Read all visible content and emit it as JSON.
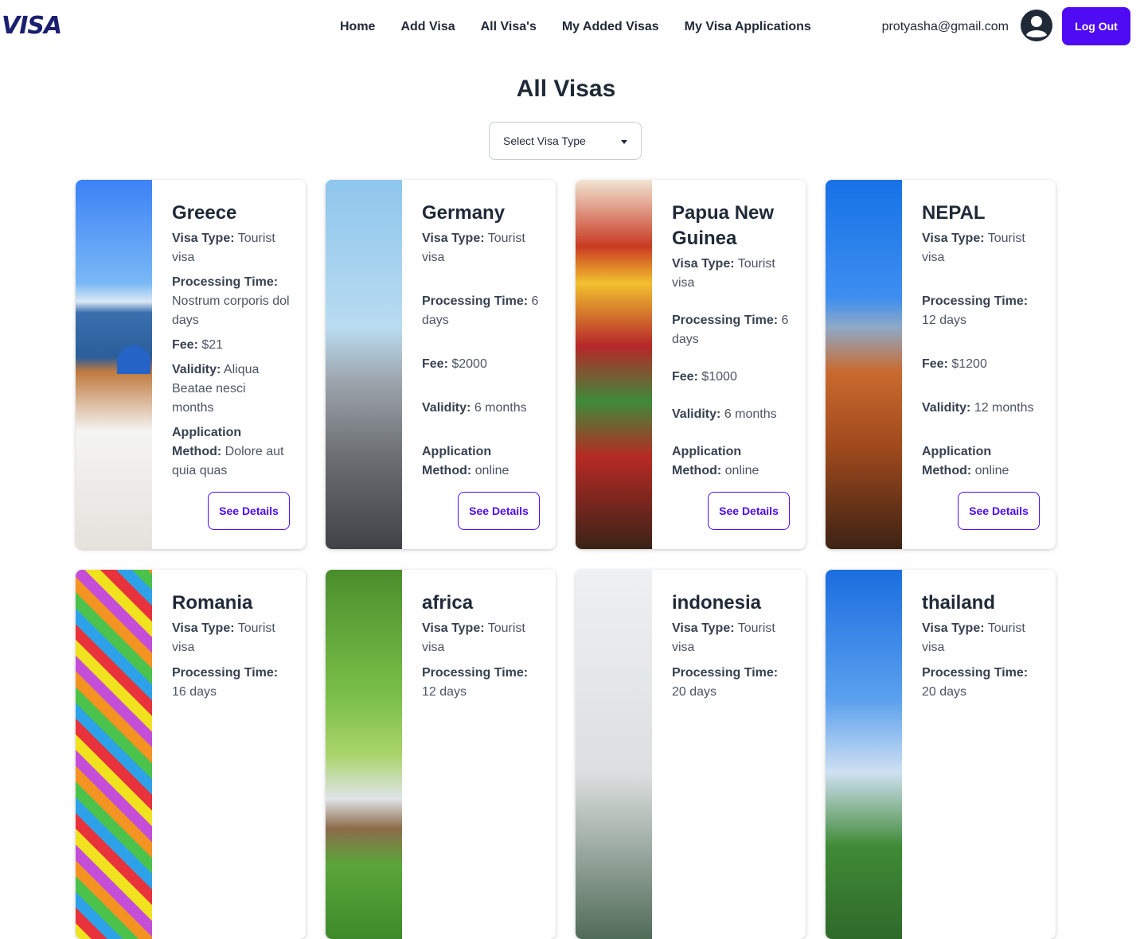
{
  "brand": {
    "logo_text": "VISA",
    "accent_color": "#4f0bf4",
    "logo_color": "#1a1f71"
  },
  "nav": {
    "links": [
      "Home",
      "Add Visa",
      "All Visa's",
      "My Added Visas",
      "My Visa Applications"
    ]
  },
  "user": {
    "email": "protyasha@gmail.com",
    "avatar_icon": "user-circle-icon",
    "logout_label": "Log Out"
  },
  "page": {
    "title": "All Visas",
    "filter": {
      "selected": "Select Visa Type"
    }
  },
  "labels": {
    "visa_type": "Visa Type:",
    "processing_time": "Processing Time:",
    "fee": "Fee:",
    "validity": "Validity:",
    "application_method": "Application Method:",
    "see_details": "See Details"
  },
  "visas": [
    {
      "country": "Greece",
      "visa_type": "Tourist visa",
      "processing_time": "Nostrum corporis dol days",
      "fee": "$21",
      "validity": "Aliqua Beatae nesci months",
      "application_method": "Dolore aut quia quas"
    },
    {
      "country": "Germany",
      "visa_type": "Tourist visa",
      "processing_time": "6 days",
      "fee": "$2000",
      "validity": "6 months",
      "application_method": "online"
    },
    {
      "country": "Papua New Guinea",
      "visa_type": "Tourist visa",
      "processing_time": "6 days",
      "fee": "$1000",
      "validity": "6 months",
      "application_method": "online"
    },
    {
      "country": "NEPAL",
      "visa_type": "Tourist visa",
      "processing_time": "12 days",
      "fee": "$1200",
      "validity": "12 months",
      "application_method": "online"
    },
    {
      "country": "Romania",
      "visa_type": "Tourist visa",
      "processing_time": "16 days"
    },
    {
      "country": "africa",
      "visa_type": "Tourist visa",
      "processing_time": "12 days"
    },
    {
      "country": "indonesia",
      "visa_type": "Tourist visa",
      "processing_time": "20 days"
    },
    {
      "country": "thailand",
      "visa_type": "Tourist visa",
      "processing_time": "20 days"
    }
  ]
}
